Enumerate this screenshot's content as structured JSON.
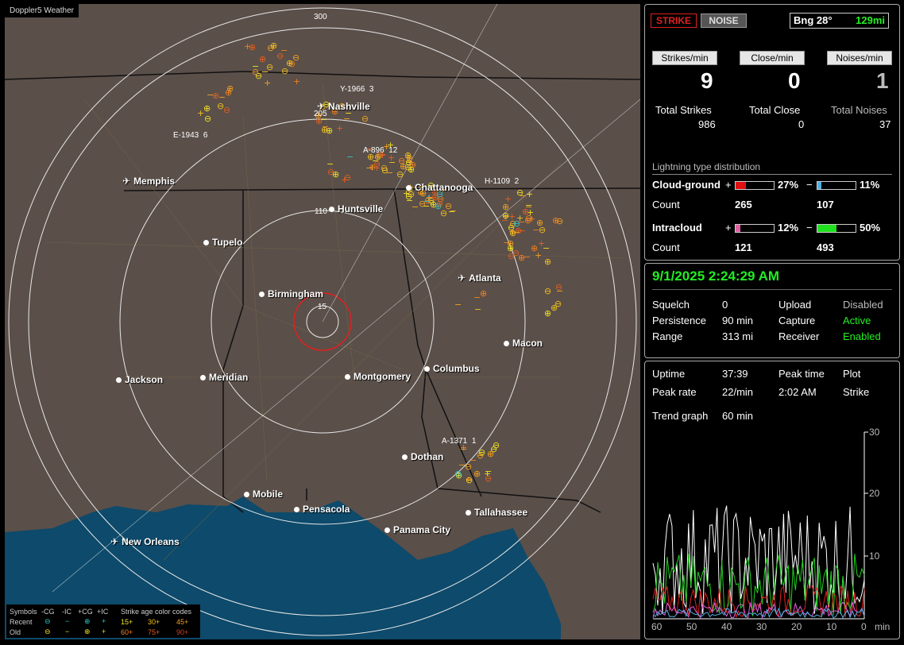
{
  "app_title": "Doppler5 Weather",
  "map": {
    "cities": [
      {
        "name": "Nashville",
        "kind": "airport"
      },
      {
        "name": "Memphis",
        "kind": "airport"
      },
      {
        "name": "Chattanooga",
        "kind": "city"
      },
      {
        "name": "Huntsville",
        "kind": "city"
      },
      {
        "name": "Tupelo",
        "kind": "city"
      },
      {
        "name": "Birmingham",
        "kind": "city"
      },
      {
        "name": "Atlanta",
        "kind": "airport"
      },
      {
        "name": "Macon",
        "kind": "city"
      },
      {
        "name": "Jackson",
        "kind": "city"
      },
      {
        "name": "Meridian",
        "kind": "city"
      },
      {
        "name": "Montgomery",
        "kind": "city"
      },
      {
        "name": "Columbus",
        "kind": "city"
      },
      {
        "name": "Dothan",
        "kind": "city"
      },
      {
        "name": "Mobile",
        "kind": "city"
      },
      {
        "name": "Pensacola",
        "kind": "city"
      },
      {
        "name": "Tallahassee",
        "kind": "city"
      },
      {
        "name": "Panama City",
        "kind": "city"
      },
      {
        "name": "New Orleans",
        "kind": "airport"
      }
    ],
    "range_labels": [
      "300",
      "205",
      "110",
      "15"
    ],
    "storm_labels": [
      "Y-1966",
      "3",
      "E-1943",
      "6",
      "A-896",
      "12",
      "H-1109",
      "2",
      "A-1371",
      "1"
    ],
    "legend": {
      "symbols_label": "Symbols",
      "recent_label": "Recent",
      "old_label": "Old",
      "col_neg_cg": "-CG",
      "col_neg_ic": "-IC",
      "col_pos_cg": "+CG",
      "col_pos_ic": "+IC",
      "age_title": "Strike age color codes",
      "ages": [
        "15+",
        "30+",
        "45+",
        "60+",
        "75+",
        "90+"
      ]
    }
  },
  "status": {
    "strike_label": "STRIKE",
    "noise_label": "NOISE",
    "bearing": "Bng 28°",
    "distance": "129mi",
    "strikes_per_min_label": "Strikes/min",
    "close_per_min_label": "Close/min",
    "noises_per_min_label": "Noises/min",
    "strikes_per_min": "9",
    "close_per_min": "0",
    "noises_per_min": "1",
    "total_strikes_label": "Total Strikes",
    "total_close_label": "Total Close",
    "total_noises_label": "Total Noises",
    "total_strikes": "986",
    "total_close": "0",
    "total_noises": "37",
    "dist_title": "Lightning type distribution",
    "cg_label": "Cloud-ground",
    "ic_label": "Intracloud",
    "count_label": "Count",
    "plus": "+",
    "minus": "−",
    "cg_pos_pct": "27%",
    "cg_neg_pct": "11%",
    "ic_pos_pct": "12%",
    "ic_neg_pct": "50%",
    "cg_pos_count": "265",
    "cg_neg_count": "107",
    "ic_pos_count": "121",
    "ic_neg_count": "493",
    "cg_pos_frac": 0.27,
    "cg_neg_frac": 0.11,
    "ic_pos_frac": 0.12,
    "ic_neg_frac": 0.5
  },
  "settings": {
    "datetime": "9/1/2025 2:24:29 AM",
    "squelch_label": "Squelch",
    "squelch": "0",
    "persistence_label": "Persistence",
    "persistence": "90 min",
    "range_label": "Range",
    "range": "313 mi",
    "upload_label": "Upload",
    "upload": "Disabled",
    "capture_label": "Capture",
    "capture": "Active",
    "receiver_label": "Receiver",
    "receiver": "Enabled"
  },
  "trend": {
    "uptime_label": "Uptime",
    "uptime": "37:39",
    "peak_time_label": "Peak time",
    "plot_label": "Plot",
    "peak_rate_label": "Peak rate",
    "peak_rate": "22/min",
    "peak_time": "2:02 AM",
    "plot": "Strike",
    "trend_graph_label": "Trend graph",
    "trend_graph": "60 min",
    "y_ticks": [
      "30",
      "20",
      "10"
    ],
    "x_ticks": [
      "60",
      "50",
      "40",
      "30",
      "20",
      "10",
      "0"
    ],
    "x_unit": "min"
  }
}
